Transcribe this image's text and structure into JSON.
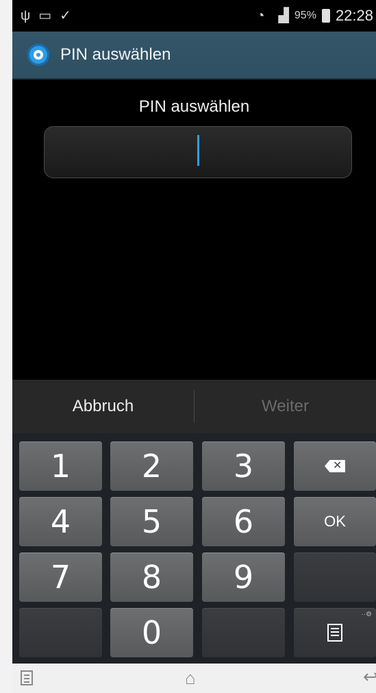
{
  "status_bar": {
    "icons": [
      "usb-icon",
      "keyboard-icon",
      "check-mark-icon"
    ],
    "battery_percent": "95%",
    "time": "22:28",
    "signal_icons": [
      "wifi-icon",
      "signal-icon",
      "battery-icon"
    ]
  },
  "action_bar": {
    "icon": "settings-gear-icon",
    "title": "PIN auswählen"
  },
  "content": {
    "prompt": "PIN auswählen",
    "pin_value": ""
  },
  "buttons": {
    "cancel": "Abbruch",
    "next": "Weiter"
  },
  "keypad": {
    "k1": "1",
    "k2": "2",
    "k3": "3",
    "k4": "4",
    "k5": "5",
    "k6": "6",
    "k7": "7",
    "k8": "8",
    "k9": "9",
    "k0": "0",
    "ok": "OK"
  },
  "colors": {
    "action_bar": "#345669",
    "cursor": "#2f9ef0",
    "accent_gear": "#2d9ce8"
  }
}
